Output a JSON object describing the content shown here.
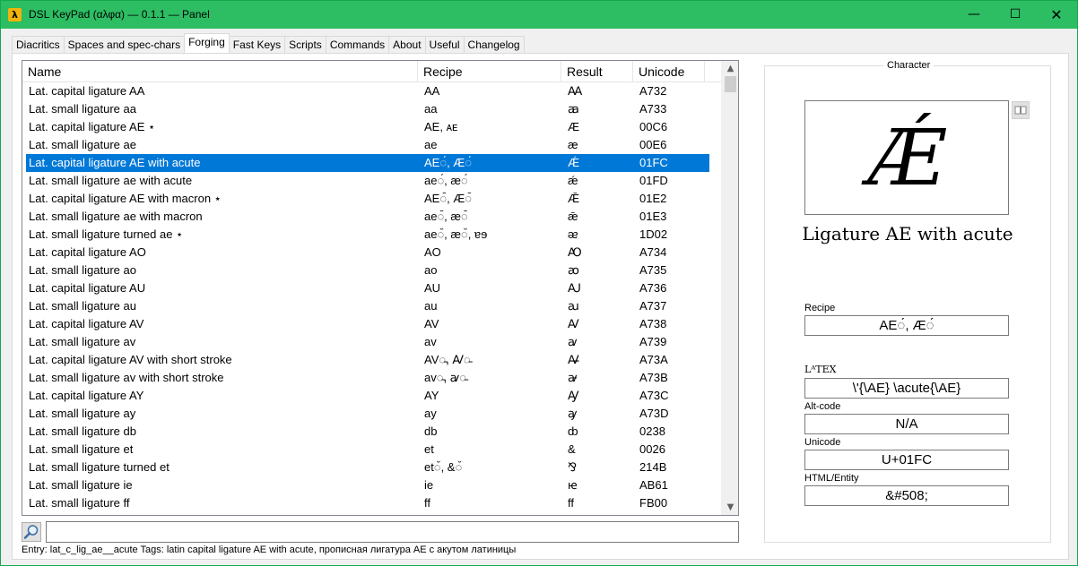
{
  "window": {
    "title": "DSL KeyPad (αλφα) — 0.1.1 — Panel",
    "app_icon_glyph": "λ",
    "controls": {
      "minimize": "—",
      "maximize": "☐",
      "close": "✕"
    }
  },
  "tabs": [
    {
      "label": "Diacritics"
    },
    {
      "label": "Spaces and spec-chars"
    },
    {
      "label": "Forging",
      "active": true
    },
    {
      "label": "Fast Keys"
    },
    {
      "label": "Scripts"
    },
    {
      "label": "Commands"
    },
    {
      "label": "About"
    },
    {
      "label": "Useful"
    },
    {
      "label": "Changelog"
    }
  ],
  "table": {
    "columns": [
      "Name",
      "Recipe",
      "Result",
      "Unicode"
    ],
    "rows": [
      [
        "Lat. capital ligature AA",
        "AA",
        "Ꜳ",
        "A732"
      ],
      [
        "Lat. small ligature aa",
        "aa",
        "ꜳ",
        "A733"
      ],
      [
        "Lat. capital ligature AE ⋆",
        "AE, ᴀᴇ",
        "Æ",
        "00C6"
      ],
      [
        "Lat. small ligature ae",
        "ae",
        "æ",
        "00E6"
      ],
      [
        "Lat. capital ligature AE with acute",
        "AE◌́, Æ◌́",
        "Ǽ",
        "01FC"
      ],
      [
        "Lat. small ligature ae with acute",
        "ae◌́, æ◌́",
        "ǽ",
        "01FD"
      ],
      [
        "Lat. capital ligature AE with macron ⋆",
        "AE◌̄, Æ◌̄",
        "Ǣ",
        "01E2"
      ],
      [
        "Lat. small ligature ae with macron",
        "ae◌̄, æ◌̄",
        "ǣ",
        "01E3"
      ],
      [
        "Lat. small ligature turned ae ⋆",
        "ae◌̆, æ◌̆, ɐɘ",
        "ᴂ",
        "1D02"
      ],
      [
        "Lat. capital ligature AO",
        "AO",
        "Ꜵ",
        "A734"
      ],
      [
        "Lat. small ligature ao",
        "ao",
        "ꜵ",
        "A735"
      ],
      [
        "Lat. capital ligature AU",
        "AU",
        "Ꜷ",
        "A736"
      ],
      [
        "Lat. small ligature au",
        "au",
        "ꜷ",
        "A737"
      ],
      [
        "Lat. capital ligature AV",
        "AV",
        "Ꜹ",
        "A738"
      ],
      [
        "Lat. small ligature av",
        "av",
        "ꜹ",
        "A739"
      ],
      [
        "Lat. capital ligature AV with short stroke",
        "AV◌̵, Ꜹ◌̵",
        "Ꜻ",
        "A73A"
      ],
      [
        "Lat. small ligature av with short stroke",
        "av◌̵, ꜹ◌̵",
        "ꜻ",
        "A73B"
      ],
      [
        "Lat. capital ligature AY",
        "AY",
        "Ꜽ",
        "A73C"
      ],
      [
        "Lat. small ligature ay",
        "ay",
        "ꜽ",
        "A73D"
      ],
      [
        "Lat. small ligature db",
        "db",
        "ȸ",
        "0238"
      ],
      [
        "Lat. small ligature et",
        "et",
        "&",
        "0026"
      ],
      [
        "Lat. small ligature turned et",
        "et◌̆, &◌̆",
        "⅋",
        "214B"
      ],
      [
        "Lat. small ligature ie",
        "ie",
        "ꭡ",
        "AB61"
      ],
      [
        "Lat. small ligature ff",
        "ff",
        "ff",
        "FB00"
      ]
    ],
    "selected_index": 4
  },
  "search": {
    "value": ""
  },
  "status": "Entry: lat_c_lig_ae__acute  Tags: latin capital ligature AE with acute, прописная лигатура AE с акутом латиницы",
  "character": {
    "legend": "Character",
    "glyph": "Ǽ",
    "name": "Ligature AE with acute",
    "recipe_label": "Recipe",
    "recipe": "AE◌́, Æ◌́",
    "latex_label": "LᴬTEX",
    "latex": "\\'{\\AE}  \\acute{\\AE}",
    "altcode_label": "Alt-code",
    "altcode": "N/A",
    "unicode_label": "Unicode",
    "unicode": "U+01FC",
    "html_label": "HTML/Entity",
    "html": "&#508;"
  },
  "icons": {
    "search": "magnifier-icon",
    "book": "book-icon"
  },
  "colors": {
    "titlebar": "#2dbd63",
    "selection": "#0078d7",
    "app_icon": "#f2b40a"
  }
}
